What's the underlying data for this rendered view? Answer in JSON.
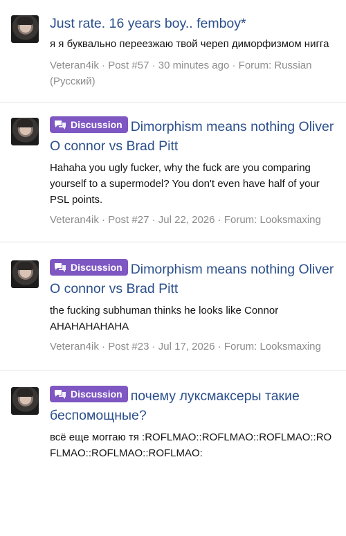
{
  "posts": [
    {
      "title": "Just rate. 16 years boy.. femboy*",
      "badge": "",
      "snippet": "я я буквально переезжаю твой череп диморфизмом нигга",
      "meta": "Veteran4ik · Post #57 · 30 minutes ago · Forum: Russian (Русский)"
    },
    {
      "title": "Dimorphism means nothing Oliver O connor vs Brad Pitt",
      "badge": "Discussion",
      "snippet": "Hahaha you ugly fucker, why the fuck are you comparing yourself to a supermodel? You don't even have half of your PSL points.",
      "meta": "Veteran4ik · Post #27 · Jul 22, 2026 · Forum: Looksmaxing"
    },
    {
      "title": "Dimorphism means nothing Oliver O connor vs Brad Pitt",
      "badge": "Discussion",
      "snippet": "the fucking subhuman thinks he looks like Connor АНАНАНАНАНА",
      "meta": "Veteran4ik · Post #23 · Jul 17, 2026 · Forum: Looksmaxing"
    },
    {
      "title": "почему луксмаксеры такие беспомощные?",
      "badge": "Discussion",
      "snippet": "всё еще моггаю тя :ROFLMAO::ROFLMAO::ROFLMAO::ROFLMAO::ROFLMAO::ROFLMAO:",
      "meta": ""
    }
  ],
  "colors": {
    "link": "#2b4f8c",
    "badge": "#7e57c2",
    "meta": "#8c8c8c"
  },
  "icons": {
    "badge": "chat-bubbles-icon",
    "avatar": "user-avatar"
  }
}
